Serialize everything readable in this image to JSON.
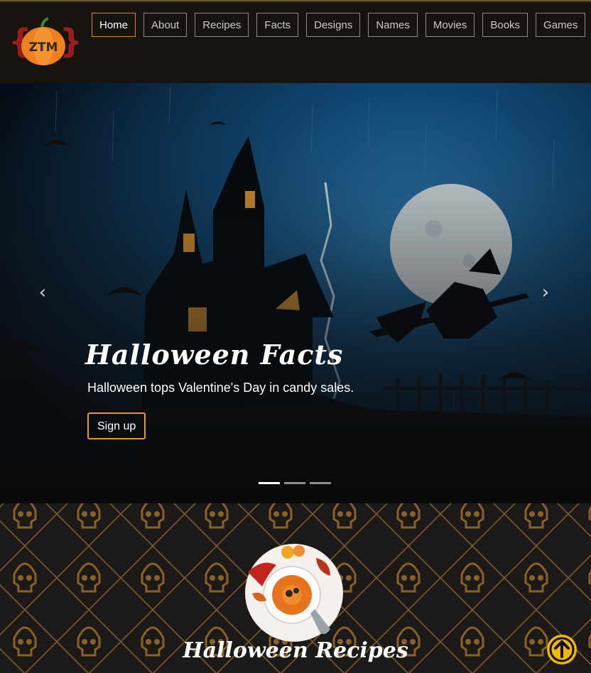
{
  "logo": {
    "text": "ZTM"
  },
  "nav": {
    "items": [
      {
        "label": "Home",
        "active": true
      },
      {
        "label": "About"
      },
      {
        "label": "Recipes"
      },
      {
        "label": "Facts"
      },
      {
        "label": "Designs"
      },
      {
        "label": "Names"
      },
      {
        "label": "Movies"
      },
      {
        "label": "Books"
      },
      {
        "label": "Games"
      }
    ]
  },
  "carousel": {
    "title": "Halloween Facts",
    "text": "Halloween tops Valentine's Day in candy sales.",
    "button": "Sign up",
    "prev_icon": "‹",
    "next_icon": "›",
    "slides": 3,
    "active_slide": 1
  },
  "section": {
    "title": "Halloween Recipes"
  },
  "colors": {
    "accent": "#e39a2b",
    "scroll_top": "#f2b705"
  }
}
